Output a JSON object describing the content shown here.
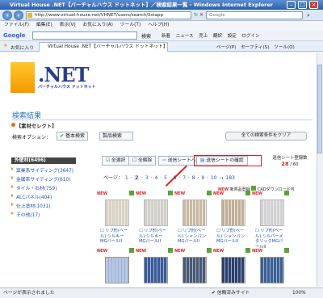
{
  "window": {
    "title": "Virtual House .NET【バーチャルハウス ドットネット】／検索結果一覧 - Windows Internet Explorer"
  },
  "address": {
    "url": "http://www.virtual-house.net/VHNET/users/search/listapp",
    "search_placeholder": "Google"
  },
  "menu": [
    "ファイル(F)",
    "編集(E)",
    "表示(V)",
    "お気に入り(A)",
    "ツール(T)",
    "ヘルプ(H)"
  ],
  "google_bar": {
    "label": "Google",
    "search_btn": "検索",
    "items": [
      "新着",
      "ニュース",
      "売上",
      "翻訳",
      "設定",
      "ログイン"
    ]
  },
  "tabs": {
    "favorites": "お気に入り",
    "active": "Virtual House .NET【バーチャルハウス ドットネット】",
    "tools": [
      "ページ(P)",
      "セーフティ(S)",
      "ツール(O)"
    ]
  },
  "logo": {
    "net": ".NET",
    "sub": "バーチャルハウス ドットネット"
  },
  "page": {
    "heading": "検索結果",
    "subheading": "【素材セレクト】",
    "options_label": "検索オプション：",
    "opt_basic": "基本検索",
    "opt_product": "製品検索",
    "clear_all": "全ての検索条件をクリア"
  },
  "sidebar": {
    "header": "外壁材(6496)",
    "items": [
      "窯業系サイディング(3647)",
      "金属系サイディング(610)",
      "タイル・石材(759)",
      "ALCパネル(404)",
      "仕上塗材(1031)",
      "その他(17)"
    ]
  },
  "toolbar": {
    "select_all": "全選択",
    "deselect_all": "全解除",
    "register": "送信シートへ登録",
    "confirm": "送信シートの確認",
    "counter_label": "送信シート登録数",
    "counter_value": "28",
    "counter_max": "/ 60"
  },
  "pager": {
    "label": "ページ：",
    "first": "1",
    "current": "2",
    "pages": [
      "3",
      "4",
      "5",
      "6",
      "7",
      "8",
      "9",
      "10"
    ],
    "next": "→",
    "last": "183"
  },
  "legend": {
    "new_label": "新商品登録",
    "cad_label": "CADダウンロード可"
  },
  "products": [
    {
      "name": "リブ形(ベール) シルキーMGバールII",
      "new": "NEW"
    },
    {
      "name": "リブ形(ベール) シルキーMGバールII",
      "new": "NEW"
    },
    {
      "name": "リブ形(ベール) シャンパンMGバールII",
      "new": "NEW"
    },
    {
      "name": "リブ形(ベール) シャンパンMGバールII",
      "new": "NEW"
    },
    {
      "name": "リブ形(ベール) シルバーメタリックMGバールII",
      "new": "NEW"
    }
  ],
  "products_row2": [
    {
      "new": "NEW"
    },
    {
      "new": "NEW"
    },
    {
      "new": "NEW"
    },
    {
      "new": "NEW"
    },
    {
      "new": "NEW"
    }
  ],
  "status": {
    "left": "ページが表示されました",
    "zone": "信頼済みサイト",
    "zoom": "100%"
  },
  "colors": {
    "accent": "#1f6fc4",
    "highlight": "#d31f1f",
    "orange": "#ea6d0c"
  }
}
